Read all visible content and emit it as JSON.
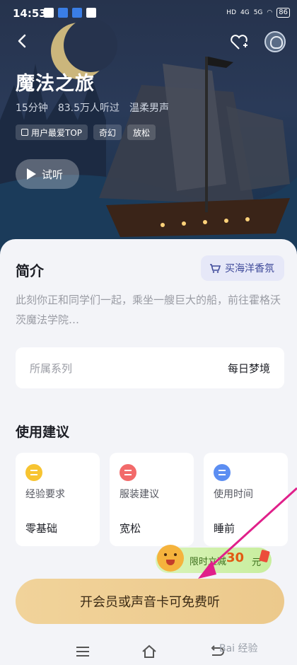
{
  "status_bar": {
    "time": "14:53",
    "net_left": "4G",
    "net_right": "5G",
    "battery": "86"
  },
  "header": {
    "title": "魔法之旅",
    "duration": "15分钟",
    "listeners": "83.5万人听过",
    "voice": "温柔男声"
  },
  "tags": [
    "用户最爱TOP",
    "奇幻",
    "放松"
  ],
  "listen_button": {
    "label": "试听"
  },
  "intro": {
    "title": "简介",
    "shop_label": "买海洋香氛",
    "description": "此刻你正和同学们一起，乘坐一艘巨大的船，前往霍格沃茨魔法学院…"
  },
  "series": {
    "key": "所属系列",
    "value": "每日梦境"
  },
  "advice": {
    "title": "使用建议",
    "cards": [
      {
        "label": "经验要求",
        "value": "零基础",
        "icon": "experience-icon"
      },
      {
        "label": "服装建议",
        "value": "宽松",
        "icon": "clothing-icon"
      },
      {
        "label": "使用时间",
        "value": "睡前",
        "icon": "clock-icon"
      }
    ]
  },
  "promo": {
    "text": "限时立减",
    "amount": "30",
    "unit": "元"
  },
  "cta": {
    "label": "开会员或声音卡可免费听"
  },
  "watermark": "Bai 经验",
  "colors": {
    "accent": "#3f4a9a",
    "cta": "#f1d39a",
    "annotation_arrow": "#e0208a"
  }
}
